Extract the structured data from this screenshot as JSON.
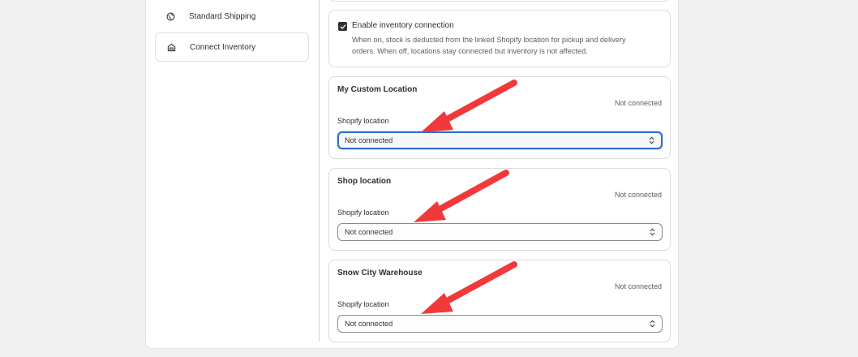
{
  "sidebar": {
    "items": [
      {
        "label": "Standard Shipping",
        "icon": "globe-icon"
      },
      {
        "label": "Connect Inventory",
        "icon": "store-icon"
      }
    ]
  },
  "inventory": {
    "enable_label": "Enable inventory connection",
    "enable_help": "When on, stock is deducted from the linked Shopify location for pickup and delivery orders. When off, locations stay connected but inventory is not affected.",
    "enabled": true
  },
  "locations": [
    {
      "name": "My Custom Location",
      "status": "Not connected",
      "field_label": "Shopify location",
      "selected": "Not connected"
    },
    {
      "name": "Shop location",
      "status": "Not connected",
      "field_label": "Shopify location",
      "selected": "Not connected"
    },
    {
      "name": "Snow City Warehouse",
      "status": "Not connected",
      "field_label": "Shopify location",
      "selected": "Not connected"
    }
  ],
  "colors": {
    "annotation_arrow": "#f0393b",
    "focus_ring": "#2c6ecb"
  }
}
